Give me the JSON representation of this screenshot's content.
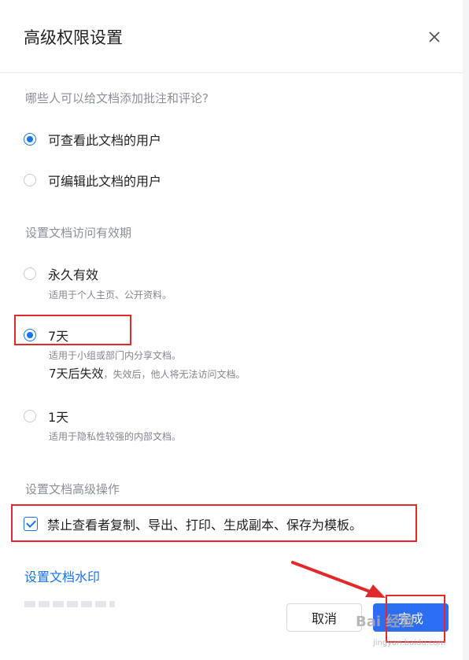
{
  "dialog": {
    "title": "高级权限设置"
  },
  "annotate": {
    "title": "哪些人可以给文档添加批注和评论?",
    "options": [
      {
        "label": "可查看此文档的用户",
        "selected": true
      },
      {
        "label": "可编辑此文档的用户",
        "selected": false
      }
    ]
  },
  "validity": {
    "title": "设置文档访问有效期",
    "options": [
      {
        "label": "永久有效",
        "desc": "适用于个人主页、公开资料。",
        "selected": false
      },
      {
        "label": "7天",
        "desc": "适用于小组或部门内分享文档。",
        "extra_main": "7天后失效",
        "extra_note": "，失效后，他人将无法访问文档。",
        "selected": true
      },
      {
        "label": "1天",
        "desc": "适用于隐私性较强的内部文档。",
        "selected": false
      }
    ]
  },
  "advanced": {
    "title": "设置文档高级操作",
    "checkbox_label": "禁止查看者复制、导出、打印、生成副本、保存为模板。",
    "checked": true
  },
  "watermark_link": "设置文档水印",
  "buttons": {
    "cancel": "取消",
    "ok": "完成"
  },
  "colors": {
    "accent": "#1a73e8",
    "primary_button": "#2b6df3",
    "highlight": "#e02a2a"
  },
  "overlay": {
    "watermark": "Bai 经验",
    "watermark_sub": "jingyan.baidu.com"
  }
}
